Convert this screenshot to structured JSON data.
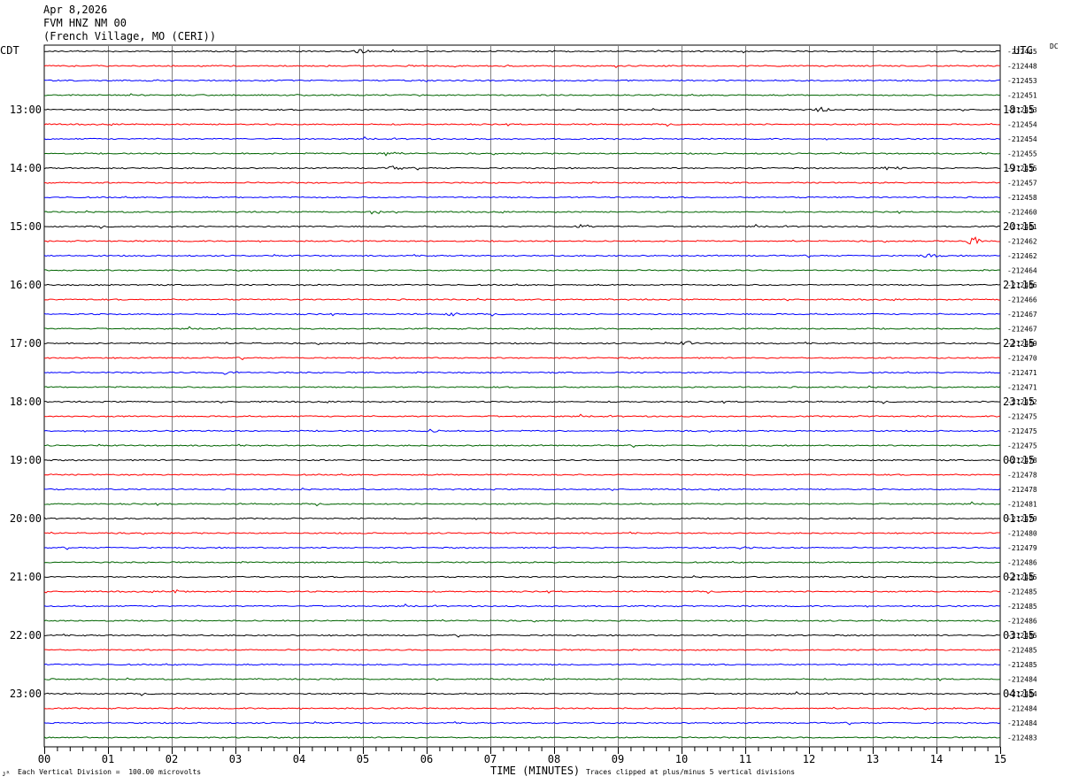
{
  "header": {
    "date": "Apr 8,2026",
    "station": "FVM HNZ NM 00",
    "location": "(French Village, MO (CERI))"
  },
  "left_axis_title": "CDT",
  "right_axis_title": "UTC",
  "dc_title": "DC",
  "footer": {
    "scale_note": "Each Vertical Division =  100.00 microvolts",
    "clip_note": "Traces clipped at plus/minus 5 vertical divisions",
    "corner_mark": "ᴊᴿ"
  },
  "chart_data": {
    "type": "line",
    "title": "FVM HNZ NM 00",
    "xlabel": "TIME (MINUTES)",
    "ylabel": "",
    "xlim": [
      0,
      15
    ],
    "x_tick_labels": [
      "00",
      "01",
      "02",
      "03",
      "04",
      "05",
      "06",
      "07",
      "08",
      "09",
      "10",
      "11",
      "12",
      "13",
      "14",
      "15"
    ],
    "grid": true,
    "row_count": 48,
    "trace_colors": [
      "#000000",
      "#ff0000",
      "#0000ff",
      "#006400"
    ],
    "left_hour_labels": [
      "13:00",
      "14:00",
      "15:00",
      "16:00",
      "17:00",
      "18:00",
      "19:00",
      "20:00",
      "21:00",
      "22:00",
      "23:00"
    ],
    "right_hour_labels": [
      "18:15",
      "19:15",
      "20:15",
      "21:15",
      "22:15",
      "23:15",
      "00:15",
      "01:15",
      "02:15",
      "03:15",
      "04:15"
    ],
    "hour_label_rows": [
      4,
      8,
      12,
      16,
      20,
      24,
      28,
      32,
      36,
      40,
      44
    ],
    "dc_offsets": [
      "-212445",
      "-212448",
      "-212453",
      "-212451",
      "-212453",
      "-212454",
      "-212454",
      "-212455",
      "-212455",
      "-212457",
      "-212458",
      "-212460",
      "-212461",
      "-212462",
      "-212462",
      "-212464",
      "-212466",
      "-212466",
      "-212467",
      "-212467",
      "-212469",
      "-212470",
      "-212471",
      "-212471",
      "-212472",
      "-212475",
      "-212475",
      "-212475",
      "-212478",
      "-212478",
      "-212478",
      "-212481",
      "-212479",
      "-212480",
      "-212479",
      "-212486",
      "-212485",
      "-212485",
      "-212485",
      "-212486",
      "-212485",
      "-212485",
      "-212485",
      "-212484",
      "-212484",
      "-212484",
      "-212484",
      "-212483"
    ],
    "events": [
      {
        "row": 0,
        "minute": 4.95,
        "amplitude": 0.4
      },
      {
        "row": 4,
        "minute": 12.2,
        "amplitude": 0.4
      },
      {
        "row": 7,
        "minute": 5.4,
        "amplitude": 0.5
      },
      {
        "row": 8,
        "minute": 5.5,
        "amplitude": 0.4
      },
      {
        "row": 8,
        "minute": 13.3,
        "amplitude": 0.4
      },
      {
        "row": 11,
        "minute": 5.2,
        "amplitude": 0.4
      },
      {
        "row": 12,
        "minute": 8.45,
        "amplitude": 0.4
      },
      {
        "row": 13,
        "minute": 14.6,
        "amplitude": 0.9
      },
      {
        "row": 14,
        "minute": 13.9,
        "amplitude": 0.4
      },
      {
        "row": 18,
        "minute": 6.4,
        "amplitude": 0.3
      },
      {
        "row": 20,
        "minute": 10.1,
        "amplitude": 0.4
      },
      {
        "row": 22,
        "minute": 2.9,
        "amplitude": 0.5
      },
      {
        "row": 26,
        "minute": 6.1,
        "amplitude": 0.3
      },
      {
        "row": 34,
        "minute": 11.0,
        "amplitude": 0.3
      },
      {
        "row": 37,
        "minute": 2.1,
        "amplitude": 0.3
      }
    ]
  }
}
